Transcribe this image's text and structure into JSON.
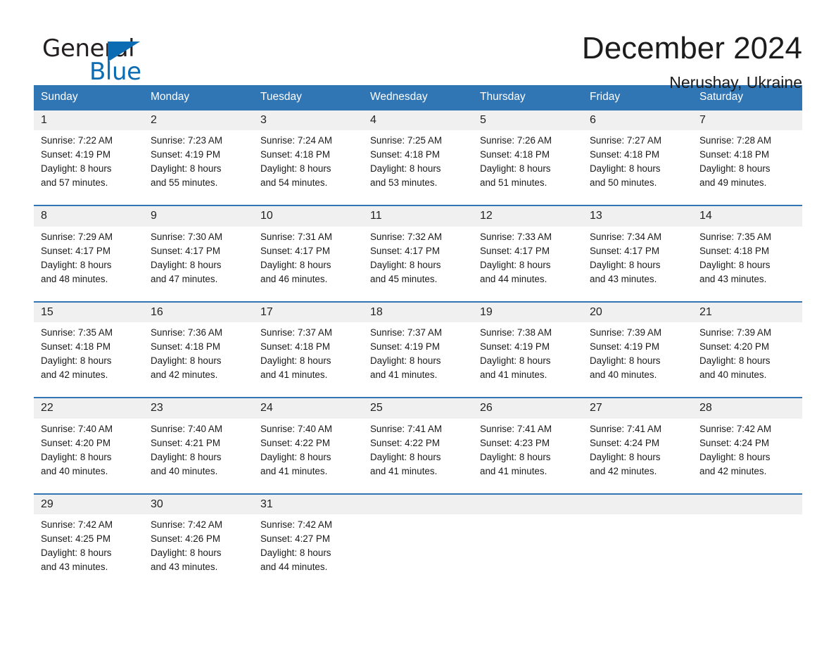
{
  "brand": {
    "name_part1": "General",
    "name_part2": "Blue",
    "triangle_color": "#0b6cb3"
  },
  "header": {
    "title": "December 2024",
    "subtitle": "Nerushay, Ukraine",
    "header_bg": "#3075b4",
    "daynum_bg": "#f0f0f0"
  },
  "weekdays": [
    "Sunday",
    "Monday",
    "Tuesday",
    "Wednesday",
    "Thursday",
    "Friday",
    "Saturday"
  ],
  "weeks": [
    {
      "days": [
        {
          "num": "1",
          "sunrise": "Sunrise: 7:22 AM",
          "sunset": "Sunset: 4:19 PM",
          "daylight1": "Daylight: 8 hours",
          "daylight2": "and 57 minutes."
        },
        {
          "num": "2",
          "sunrise": "Sunrise: 7:23 AM",
          "sunset": "Sunset: 4:19 PM",
          "daylight1": "Daylight: 8 hours",
          "daylight2": "and 55 minutes."
        },
        {
          "num": "3",
          "sunrise": "Sunrise: 7:24 AM",
          "sunset": "Sunset: 4:18 PM",
          "daylight1": "Daylight: 8 hours",
          "daylight2": "and 54 minutes."
        },
        {
          "num": "4",
          "sunrise": "Sunrise: 7:25 AM",
          "sunset": "Sunset: 4:18 PM",
          "daylight1": "Daylight: 8 hours",
          "daylight2": "and 53 minutes."
        },
        {
          "num": "5",
          "sunrise": "Sunrise: 7:26 AM",
          "sunset": "Sunset: 4:18 PM",
          "daylight1": "Daylight: 8 hours",
          "daylight2": "and 51 minutes."
        },
        {
          "num": "6",
          "sunrise": "Sunrise: 7:27 AM",
          "sunset": "Sunset: 4:18 PM",
          "daylight1": "Daylight: 8 hours",
          "daylight2": "and 50 minutes."
        },
        {
          "num": "7",
          "sunrise": "Sunrise: 7:28 AM",
          "sunset": "Sunset: 4:18 PM",
          "daylight1": "Daylight: 8 hours",
          "daylight2": "and 49 minutes."
        }
      ]
    },
    {
      "days": [
        {
          "num": "8",
          "sunrise": "Sunrise: 7:29 AM",
          "sunset": "Sunset: 4:17 PM",
          "daylight1": "Daylight: 8 hours",
          "daylight2": "and 48 minutes."
        },
        {
          "num": "9",
          "sunrise": "Sunrise: 7:30 AM",
          "sunset": "Sunset: 4:17 PM",
          "daylight1": "Daylight: 8 hours",
          "daylight2": "and 47 minutes."
        },
        {
          "num": "10",
          "sunrise": "Sunrise: 7:31 AM",
          "sunset": "Sunset: 4:17 PM",
          "daylight1": "Daylight: 8 hours",
          "daylight2": "and 46 minutes."
        },
        {
          "num": "11",
          "sunrise": "Sunrise: 7:32 AM",
          "sunset": "Sunset: 4:17 PM",
          "daylight1": "Daylight: 8 hours",
          "daylight2": "and 45 minutes."
        },
        {
          "num": "12",
          "sunrise": "Sunrise: 7:33 AM",
          "sunset": "Sunset: 4:17 PM",
          "daylight1": "Daylight: 8 hours",
          "daylight2": "and 44 minutes."
        },
        {
          "num": "13",
          "sunrise": "Sunrise: 7:34 AM",
          "sunset": "Sunset: 4:17 PM",
          "daylight1": "Daylight: 8 hours",
          "daylight2": "and 43 minutes."
        },
        {
          "num": "14",
          "sunrise": "Sunrise: 7:35 AM",
          "sunset": "Sunset: 4:18 PM",
          "daylight1": "Daylight: 8 hours",
          "daylight2": "and 43 minutes."
        }
      ]
    },
    {
      "days": [
        {
          "num": "15",
          "sunrise": "Sunrise: 7:35 AM",
          "sunset": "Sunset: 4:18 PM",
          "daylight1": "Daylight: 8 hours",
          "daylight2": "and 42 minutes."
        },
        {
          "num": "16",
          "sunrise": "Sunrise: 7:36 AM",
          "sunset": "Sunset: 4:18 PM",
          "daylight1": "Daylight: 8 hours",
          "daylight2": "and 42 minutes."
        },
        {
          "num": "17",
          "sunrise": "Sunrise: 7:37 AM",
          "sunset": "Sunset: 4:18 PM",
          "daylight1": "Daylight: 8 hours",
          "daylight2": "and 41 minutes."
        },
        {
          "num": "18",
          "sunrise": "Sunrise: 7:37 AM",
          "sunset": "Sunset: 4:19 PM",
          "daylight1": "Daylight: 8 hours",
          "daylight2": "and 41 minutes."
        },
        {
          "num": "19",
          "sunrise": "Sunrise: 7:38 AM",
          "sunset": "Sunset: 4:19 PM",
          "daylight1": "Daylight: 8 hours",
          "daylight2": "and 41 minutes."
        },
        {
          "num": "20",
          "sunrise": "Sunrise: 7:39 AM",
          "sunset": "Sunset: 4:19 PM",
          "daylight1": "Daylight: 8 hours",
          "daylight2": "and 40 minutes."
        },
        {
          "num": "21",
          "sunrise": "Sunrise: 7:39 AM",
          "sunset": "Sunset: 4:20 PM",
          "daylight1": "Daylight: 8 hours",
          "daylight2": "and 40 minutes."
        }
      ]
    },
    {
      "days": [
        {
          "num": "22",
          "sunrise": "Sunrise: 7:40 AM",
          "sunset": "Sunset: 4:20 PM",
          "daylight1": "Daylight: 8 hours",
          "daylight2": "and 40 minutes."
        },
        {
          "num": "23",
          "sunrise": "Sunrise: 7:40 AM",
          "sunset": "Sunset: 4:21 PM",
          "daylight1": "Daylight: 8 hours",
          "daylight2": "and 40 minutes."
        },
        {
          "num": "24",
          "sunrise": "Sunrise: 7:40 AM",
          "sunset": "Sunset: 4:22 PM",
          "daylight1": "Daylight: 8 hours",
          "daylight2": "and 41 minutes."
        },
        {
          "num": "25",
          "sunrise": "Sunrise: 7:41 AM",
          "sunset": "Sunset: 4:22 PM",
          "daylight1": "Daylight: 8 hours",
          "daylight2": "and 41 minutes."
        },
        {
          "num": "26",
          "sunrise": "Sunrise: 7:41 AM",
          "sunset": "Sunset: 4:23 PM",
          "daylight1": "Daylight: 8 hours",
          "daylight2": "and 41 minutes."
        },
        {
          "num": "27",
          "sunrise": "Sunrise: 7:41 AM",
          "sunset": "Sunset: 4:24 PM",
          "daylight1": "Daylight: 8 hours",
          "daylight2": "and 42 minutes."
        },
        {
          "num": "28",
          "sunrise": "Sunrise: 7:42 AM",
          "sunset": "Sunset: 4:24 PM",
          "daylight1": "Daylight: 8 hours",
          "daylight2": "and 42 minutes."
        }
      ]
    },
    {
      "days": [
        {
          "num": "29",
          "sunrise": "Sunrise: 7:42 AM",
          "sunset": "Sunset: 4:25 PM",
          "daylight1": "Daylight: 8 hours",
          "daylight2": "and 43 minutes."
        },
        {
          "num": "30",
          "sunrise": "Sunrise: 7:42 AM",
          "sunset": "Sunset: 4:26 PM",
          "daylight1": "Daylight: 8 hours",
          "daylight2": "and 43 minutes."
        },
        {
          "num": "31",
          "sunrise": "Sunrise: 7:42 AM",
          "sunset": "Sunset: 4:27 PM",
          "daylight1": "Daylight: 8 hours",
          "daylight2": "and 44 minutes."
        },
        {
          "num": "",
          "sunrise": "",
          "sunset": "",
          "daylight1": "",
          "daylight2": ""
        },
        {
          "num": "",
          "sunrise": "",
          "sunset": "",
          "daylight1": "",
          "daylight2": ""
        },
        {
          "num": "",
          "sunrise": "",
          "sunset": "",
          "daylight1": "",
          "daylight2": ""
        },
        {
          "num": "",
          "sunrise": "",
          "sunset": "",
          "daylight1": "",
          "daylight2": ""
        }
      ]
    }
  ]
}
